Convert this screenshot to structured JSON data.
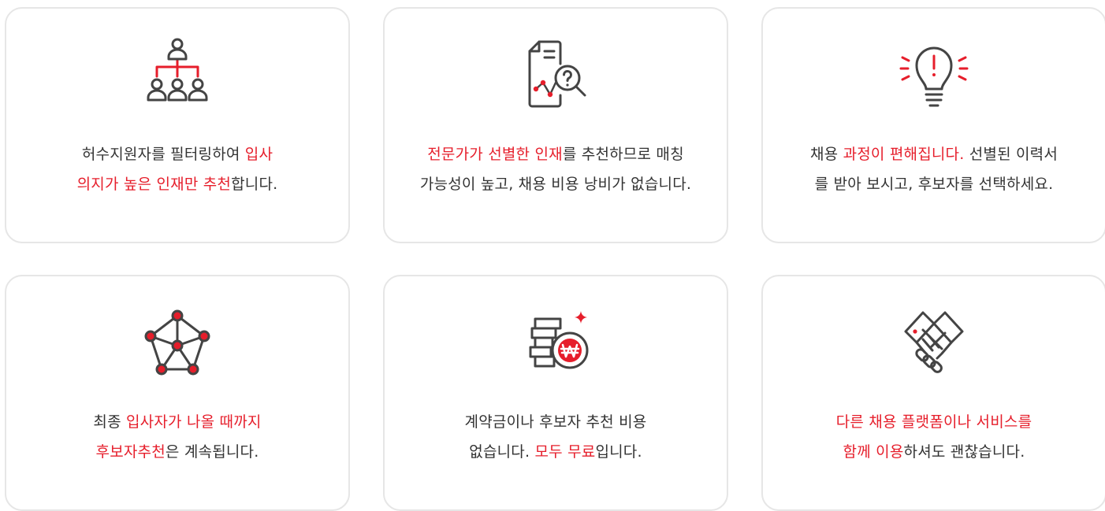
{
  "colors": {
    "accent": "#e61e2b",
    "text": "#333333",
    "icon": "#444444",
    "border": "#e6e6e6"
  },
  "cards": [
    {
      "icon": "org-chart-icon",
      "lines": [
        [
          {
            "t": "허수지원자를 필터링하여 ",
            "hl": false
          },
          {
            "t": "입사",
            "hl": true
          }
        ],
        [
          {
            "t": "의지가 높은 인재만 추천",
            "hl": true
          },
          {
            "t": "합니다.",
            "hl": false
          }
        ]
      ]
    },
    {
      "icon": "document-analysis-icon",
      "lines": [
        [
          {
            "t": "전문가가 선별한 인재",
            "hl": true
          },
          {
            "t": "를 추천하므로 매칭",
            "hl": false
          }
        ],
        [
          {
            "t": "가능성이 높고, 채용 비용 낭비가 없습니다.",
            "hl": false
          }
        ]
      ]
    },
    {
      "icon": "lightbulb-icon",
      "lines": [
        [
          {
            "t": "채용 ",
            "hl": false
          },
          {
            "t": "과정이 편해집니다.",
            "hl": true
          },
          {
            "t": " 선별된 이력서",
            "hl": false
          }
        ],
        [
          {
            "t": "를 받아 보시고, 후보자를 선택하세요.",
            "hl": false
          }
        ]
      ]
    },
    {
      "icon": "network-icon",
      "lines": [
        [
          {
            "t": "최종 ",
            "hl": false
          },
          {
            "t": "입사자가 나올 때까지",
            "hl": true
          }
        ],
        [
          {
            "t": "후보자추천",
            "hl": true
          },
          {
            "t": "은 계속됩니다.",
            "hl": false
          }
        ]
      ]
    },
    {
      "icon": "coins-won-icon",
      "lines": [
        [
          {
            "t": "계약금이나 후보자 추천 비용",
            "hl": false
          }
        ],
        [
          {
            "t": "없습니다. ",
            "hl": false
          },
          {
            "t": "모두 무료",
            "hl": true
          },
          {
            "t": "입니다.",
            "hl": false
          }
        ]
      ]
    },
    {
      "icon": "handshake-icon",
      "lines": [
        [
          {
            "t": "다른 채용 플랫폼이나 서비스를",
            "hl": true
          }
        ],
        [
          {
            "t": "함께 이용",
            "hl": true
          },
          {
            "t": "하셔도 괜찮습니다.",
            "hl": false
          }
        ]
      ]
    }
  ]
}
